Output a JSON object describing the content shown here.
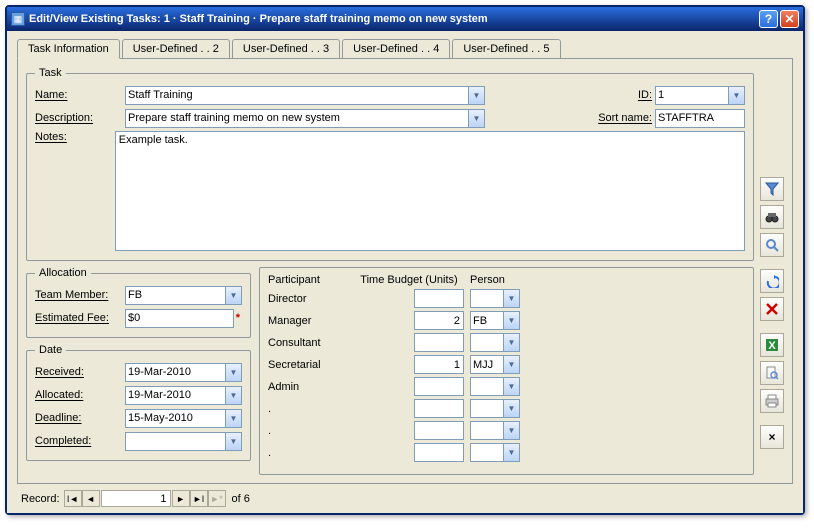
{
  "window": {
    "title": "Edit/View Existing Tasks:   1  ·  Staff Training  ·  Prepare staff training memo on new system"
  },
  "tabs": [
    "Task Information",
    "User-Defined . . 2",
    "User-Defined . . 3",
    "User-Defined . . 4",
    "User-Defined . . 5"
  ],
  "task": {
    "legend": "Task",
    "name_label": "Name:",
    "name_value": "Staff Training",
    "id_label": "ID:",
    "id_value": "1",
    "desc_label": "Description:",
    "desc_value": "Prepare staff training memo on new system",
    "sortname_label": "Sort name:",
    "sortname_value": "STAFFTRA",
    "notes_label": "Notes:",
    "notes_value": "Example task."
  },
  "allocation": {
    "legend": "Allocation",
    "team_label": "Team Member:",
    "team_value": "FB",
    "fee_label": "Estimated Fee:",
    "fee_value": "$0"
  },
  "date": {
    "legend": "Date",
    "received_label": "Received:",
    "received_value": "19-Mar-2010",
    "allocated_label": "Allocated:",
    "allocated_value": "19-Mar-2010",
    "deadline_label": "Deadline:",
    "deadline_value": "15-May-2010",
    "completed_label": "Completed:",
    "completed_value": ""
  },
  "participant_headers": [
    "Participant",
    "Time Budget (Units)",
    "Person"
  ],
  "participants": [
    {
      "role": "Director",
      "budget": "",
      "person": ""
    },
    {
      "role": "Manager",
      "budget": "2",
      "person": "FB"
    },
    {
      "role": "Consultant",
      "budget": "",
      "person": ""
    },
    {
      "role": "Secretarial",
      "budget": "1",
      "person": "MJJ"
    },
    {
      "role": "Admin",
      "budget": "",
      "person": ""
    },
    {
      "role": ".",
      "budget": "",
      "person": ""
    },
    {
      "role": ".",
      "budget": "",
      "person": ""
    },
    {
      "role": ".",
      "budget": "",
      "person": ""
    }
  ],
  "record": {
    "label": "Record:",
    "current": "1",
    "of_label": "of  6"
  },
  "side_icons": [
    "filter-icon",
    "binoculars-icon",
    "magnifier-icon",
    "undo-icon",
    "delete-icon",
    "excel-icon",
    "preview-icon",
    "print-icon",
    "close-panel-icon"
  ]
}
